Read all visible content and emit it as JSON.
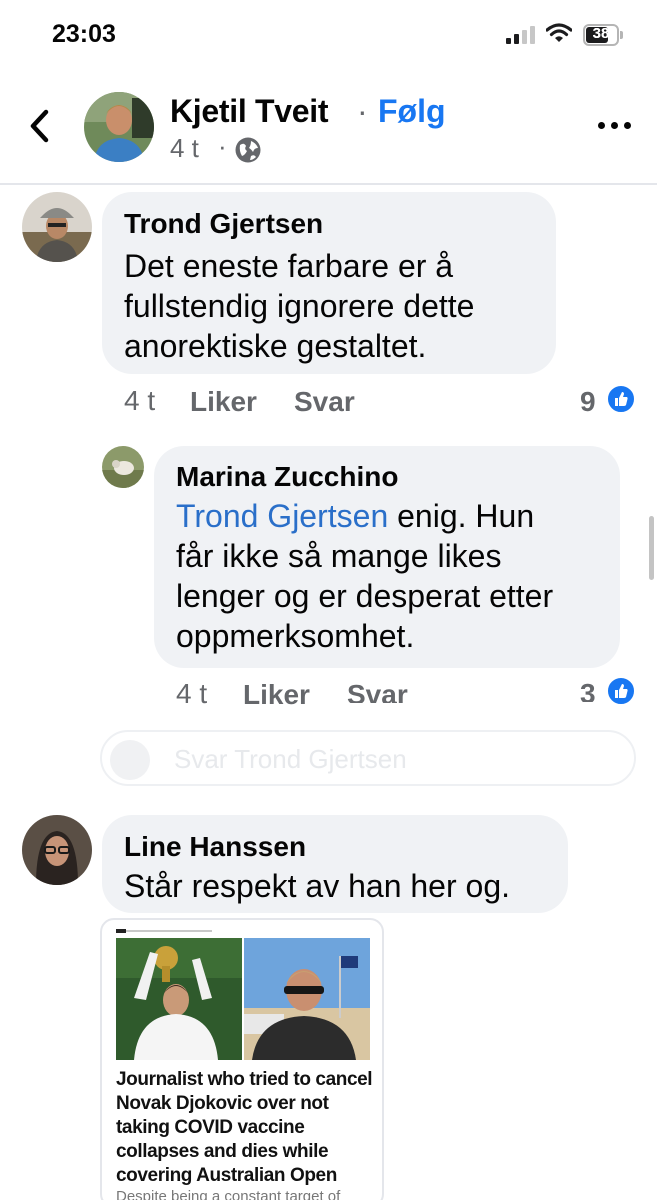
{
  "status_bar": {
    "time": "23:03",
    "battery": "38"
  },
  "header": {
    "name": "Kjetil Tveit",
    "separator": "·",
    "follow": "Følg",
    "time": "4 t",
    "time_separator": "·"
  },
  "comments": [
    {
      "name": "Trond Gjertsen",
      "lines": [
        "Det  eneste  farbare er å",
        "fullstendig  ignorere dette",
        "anorektiske gestaltet."
      ],
      "time": "4 t",
      "like": "Liker",
      "reply": "Svar",
      "reactions": "9"
    },
    {
      "name": "Marina Zucchino",
      "mention": "Trond Gjertsen",
      "lines": [
        " enig. Hun",
        "får ikke så mange likes",
        "lenger og er desperat etter",
        "oppmerksomhet."
      ],
      "time": "4 t",
      "like": "Liker",
      "reply": "Svar",
      "reactions": "3"
    },
    {
      "name": "Line Hanssen",
      "lines": [
        "Står respekt av han her og."
      ]
    }
  ],
  "reply_input": {
    "placeholder": "Svar Trond Gjertsen"
  },
  "link_card": {
    "headline": "Journalist who tried to cancel Novak Djokovic over not taking COVID vaccine collapses and dies while covering Australian Open",
    "subtext": "Despite being a constant target of"
  },
  "colors": {
    "link_blue": "#1877f2",
    "mention_blue": "#2a6fc9",
    "bubble": "#f0f2f5",
    "meta_gray": "#65676b"
  },
  "icons": [
    "back-chevron-icon",
    "globe-icon",
    "more-dots-icon",
    "like-thumb-icon",
    "signal-icon",
    "wifi-icon",
    "battery-icon"
  ]
}
